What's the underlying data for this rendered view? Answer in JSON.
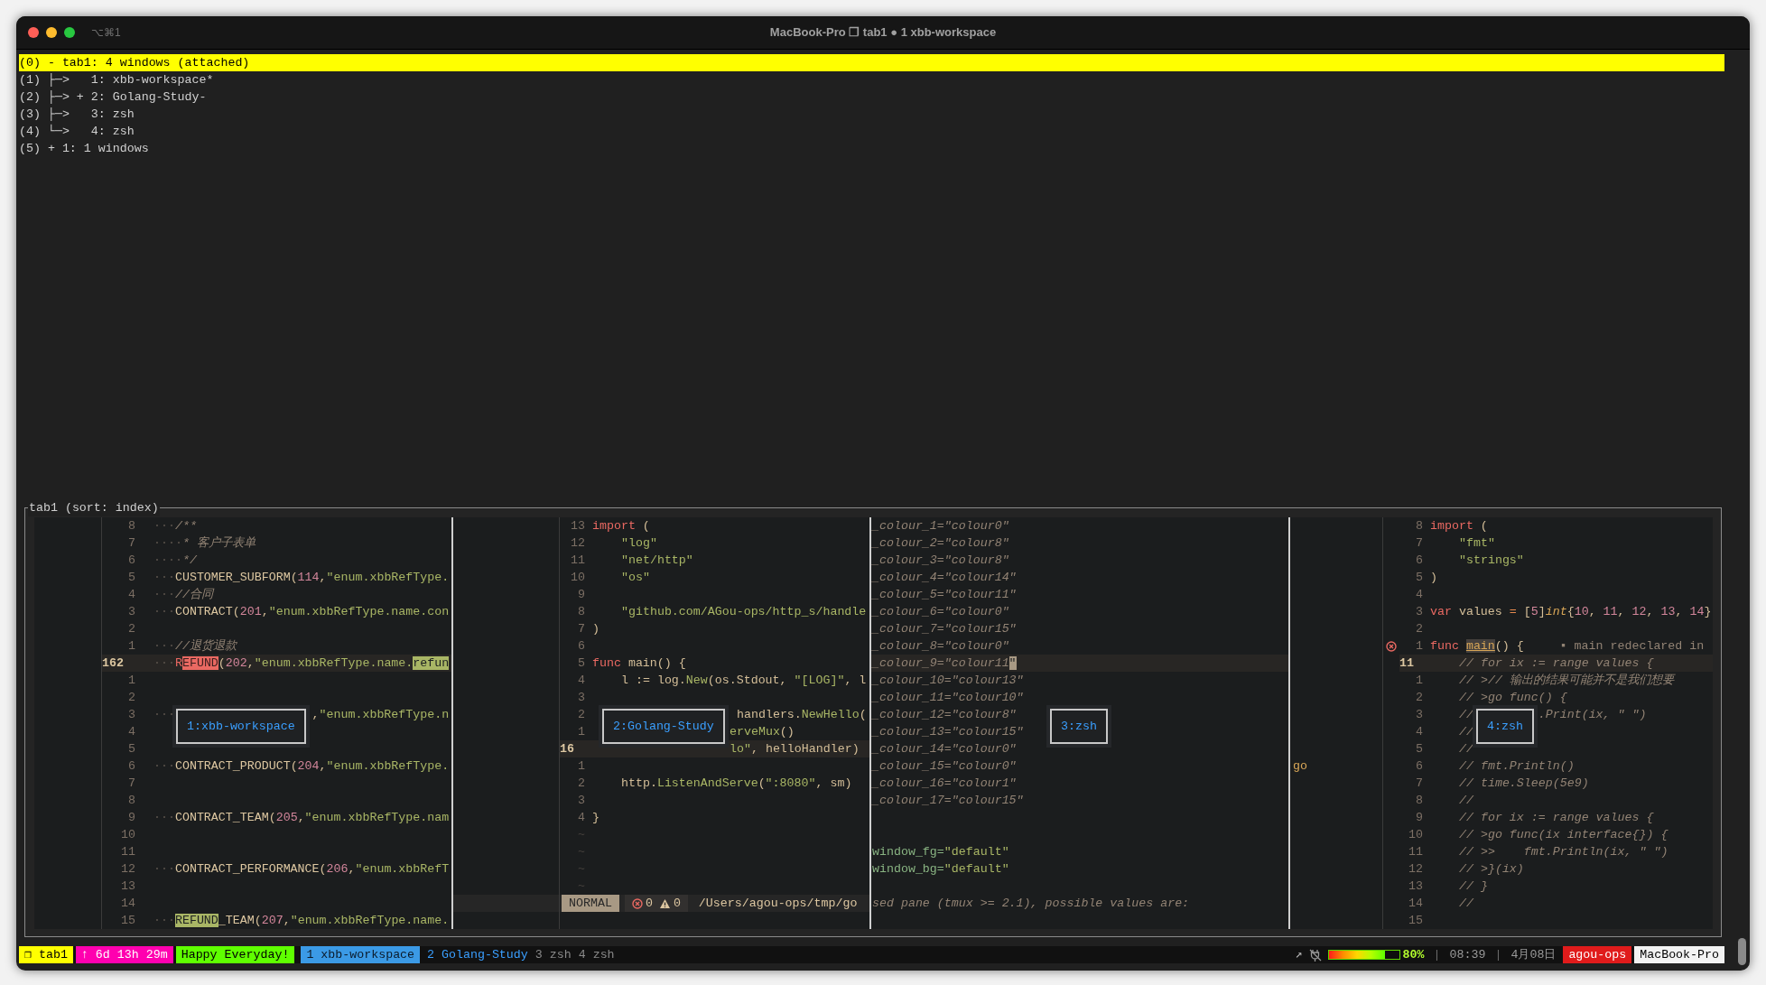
{
  "window": {
    "title": "MacBook-Pro ❐ tab1 ● 1 xbb-workspace",
    "shortcut": "⌥⌘1"
  },
  "tree": [
    {
      "index": "(0)",
      "marker": "-",
      "label": "tab1: 4 windows (attached)",
      "selected": true,
      "children": [
        {
          "index": "(1)",
          "branch": "├─>",
          "label": "1: xbb-workspace*",
          "selected": false
        },
        {
          "index": "(2)",
          "branch": "├─>",
          "marker": "+",
          "label": "2: Golang-Study-",
          "selected": false
        },
        {
          "index": "(3)",
          "branch": "├─>",
          "label": "3: zsh",
          "selected": false
        },
        {
          "index": "(4)",
          "branch": "└─>",
          "label": "4: zsh",
          "selected": false
        }
      ]
    },
    {
      "index": "(5)",
      "marker": "+",
      "label": "1: 1 windows",
      "selected": false
    }
  ],
  "preview": {
    "title": "tab1 (sort: index)",
    "panes": [
      {
        "label": "1:xbb-workspace",
        "rows": [
          {
            "num": "8",
            "current": false,
            "segments": [
              {
                "text": "···",
                "kind": "ws"
              },
              {
                "text": "/**",
                "kind": "comment"
              }
            ]
          },
          {
            "num": "7",
            "current": false,
            "segments": [
              {
                "text": "····",
                "kind": "ws"
              },
              {
                "text": "* 客户子表单",
                "kind": "comment"
              }
            ]
          },
          {
            "num": "6",
            "current": false,
            "segments": [
              {
                "text": "····",
                "kind": "ws"
              },
              {
                "text": "*/",
                "kind": "comment"
              }
            ]
          },
          {
            "num": "5",
            "current": false,
            "segments": [
              {
                "text": "···",
                "kind": "ws"
              },
              {
                "text": "CUSTOMER_SUBFORM",
                "kind": "ident"
              },
              {
                "text": "(",
                "kind": "plain"
              },
              {
                "text": "114",
                "kind": "number"
              },
              {
                "text": ",",
                "kind": "plain"
              },
              {
                "text": "\"enum.xbbRefType.",
                "kind": "string"
              }
            ]
          },
          {
            "num": "4",
            "current": false,
            "segments": [
              {
                "text": "···",
                "kind": "ws"
              },
              {
                "text": "//合同",
                "kind": "comment"
              }
            ]
          },
          {
            "num": "3",
            "current": false,
            "segments": [
              {
                "text": "···",
                "kind": "ws"
              },
              {
                "text": "CONTRACT",
                "kind": "ident"
              },
              {
                "text": "(",
                "kind": "plain"
              },
              {
                "text": "201",
                "kind": "number"
              },
              {
                "text": ",",
                "kind": "plain"
              },
              {
                "text": "\"enum.xbbRefType.name.con",
                "kind": "string"
              }
            ]
          },
          {
            "num": "2",
            "current": false
          },
          {
            "num": "1",
            "current": false,
            "segments": [
              {
                "text": "···",
                "kind": "ws"
              },
              {
                "text": "//退货退款",
                "kind": "comment"
              }
            ]
          },
          {
            "num": "162",
            "current": true,
            "segments": [
              {
                "text": "···",
                "kind": "ws"
              },
              {
                "text": "R",
                "kind": "keyword"
              },
              {
                "text": "EFUND",
                "kind": "match"
              },
              {
                "text": "(",
                "kind": "plain"
              },
              {
                "text": "202",
                "kind": "number"
              },
              {
                "text": ",",
                "kind": "plain"
              },
              {
                "text": "\"enum.xbbRefType.name.",
                "kind": "string"
              },
              {
                "text": "refun",
                "kind": "search"
              }
            ]
          },
          {
            "num": "1",
            "current": false
          },
          {
            "num": "2",
            "current": false
          },
          {
            "num": "3",
            "current": false,
            "segments": [
              {
                "text": "···",
                "kind": "ws"
              },
              {
                "text": "                   ,",
                "kind": "plain"
              },
              {
                "text": "\"enum.xbbRefType.n",
                "kind": "string"
              }
            ]
          },
          {
            "num": "4",
            "current": false
          },
          {
            "num": "5",
            "current": false
          },
          {
            "num": "6",
            "current": false,
            "segments": [
              {
                "text": "···",
                "kind": "ws"
              },
              {
                "text": "CONTRACT_PRODUCT",
                "kind": "ident"
              },
              {
                "text": "(",
                "kind": "plain"
              },
              {
                "text": "204",
                "kind": "number"
              },
              {
                "text": ",",
                "kind": "plain"
              },
              {
                "text": "\"enum.xbbRefType.",
                "kind": "string"
              }
            ]
          },
          {
            "num": "7",
            "current": false
          },
          {
            "num": "8",
            "current": false
          },
          {
            "num": "9",
            "current": false,
            "segments": [
              {
                "text": "···",
                "kind": "ws"
              },
              {
                "text": "CONTRACT_TEAM",
                "kind": "ident"
              },
              {
                "text": "(",
                "kind": "plain"
              },
              {
                "text": "205",
                "kind": "number"
              },
              {
                "text": ",",
                "kind": "plain"
              },
              {
                "text": "\"enum.xbbRefType.nam",
                "kind": "string"
              }
            ]
          },
          {
            "num": "10",
            "current": false
          },
          {
            "num": "11",
            "current": false
          },
          {
            "num": "12",
            "current": false,
            "segments": [
              {
                "text": "···",
                "kind": "ws"
              },
              {
                "text": "CONTRACT_PERFORMANCE",
                "kind": "ident"
              },
              {
                "text": "(",
                "kind": "plain"
              },
              {
                "text": "206",
                "kind": "number"
              },
              {
                "text": ",",
                "kind": "plain"
              },
              {
                "text": "\"enum.xbbRefT",
                "kind": "string"
              }
            ]
          },
          {
            "num": "13",
            "current": false
          },
          {
            "num": "14",
            "current": false
          },
          {
            "num": "15",
            "current": false,
            "segments": [
              {
                "text": "···",
                "kind": "ws"
              },
              {
                "text": "REFUND",
                "kind": "search"
              },
              {
                "text": "_TEAM",
                "kind": "ident"
              },
              {
                "text": "(",
                "kind": "plain"
              },
              {
                "text": "207",
                "kind": "number"
              },
              {
                "text": ",",
                "kind": "plain"
              },
              {
                "text": "\"enum.xbbRefType.name.",
                "kind": "string"
              }
            ]
          }
        ]
      },
      {
        "label": "2:Golang-Study",
        "rows": [
          {
            "num": "13",
            "current": false,
            "segments": [
              {
                "text": "import",
                "kind": "keyword"
              },
              {
                "text": " (",
                "kind": "plain"
              }
            ]
          },
          {
            "num": "12",
            "current": false,
            "segments": [
              {
                "text": "    \"log\"",
                "kind": "string"
              }
            ]
          },
          {
            "num": "11",
            "current": false,
            "segments": [
              {
                "text": "    \"net/http\"",
                "kind": "string"
              }
            ]
          },
          {
            "num": "10",
            "current": false,
            "segments": [
              {
                "text": "    \"os\"",
                "kind": "string"
              }
            ]
          },
          {
            "num": "9",
            "current": false
          },
          {
            "num": "8",
            "current": false,
            "segments": [
              {
                "text": "    \"github.com/AGou-ops/http_s/handle",
                "kind": "string"
              }
            ]
          },
          {
            "num": "7",
            "current": false,
            "segments": [
              {
                "text": ")",
                "kind": "plain"
              }
            ]
          },
          {
            "num": "6",
            "current": false
          },
          {
            "num": "5",
            "current": false,
            "segments": [
              {
                "text": "func",
                "kind": "keyword"
              },
              {
                "text": " main() {",
                "kind": "plain"
              }
            ]
          },
          {
            "num": "4",
            "current": false,
            "segments": [
              {
                "text": "    l := log.",
                "kind": "plain"
              },
              {
                "text": "New",
                "kind": "func"
              },
              {
                "text": "(os.Stdout, ",
                "kind": "plain"
              },
              {
                "text": "\"[LOG]\"",
                "kind": "string"
              },
              {
                "text": ", l",
                "kind": "plain"
              }
            ]
          },
          {
            "num": "3",
            "current": false
          },
          {
            "num": "2",
            "current": false,
            "segments": [
              {
                "text": "                    handlers.",
                "kind": "plain"
              },
              {
                "text": "NewHello",
                "kind": "func"
              },
              {
                "text": "(",
                "kind": "plain"
              }
            ]
          },
          {
            "num": "1",
            "current": false,
            "segments": [
              {
                "text": "                   erveMux",
                "kind": "func"
              },
              {
                "text": "()",
                "kind": "plain"
              }
            ]
          },
          {
            "num": "16",
            "current": true,
            "segments": [
              {
                "text": "                   lo\"",
                "kind": "string"
              },
              {
                "text": ", helloHandler)",
                "kind": "plain"
              }
            ]
          },
          {
            "num": "1",
            "current": false
          },
          {
            "num": "2",
            "current": false,
            "segments": [
              {
                "text": "    http.",
                "kind": "plain"
              },
              {
                "text": "ListenAndServe",
                "kind": "func"
              },
              {
                "text": "(",
                "kind": "plain"
              },
              {
                "text": "\":8080\"",
                "kind": "string"
              },
              {
                "text": ", sm)",
                "kind": "plain"
              }
            ]
          },
          {
            "num": "3",
            "current": false
          },
          {
            "num": "4",
            "current": false,
            "segments": [
              {
                "text": "}",
                "kind": "plain"
              }
            ]
          },
          {
            "num": "~",
            "kind": "filler",
            "current": false
          },
          {
            "num": "~",
            "kind": "filler",
            "current": false
          },
          {
            "num": "~",
            "kind": "filler",
            "current": false
          },
          {
            "num": "~",
            "kind": "filler",
            "current": false
          },
          {
            "kind": "statusline",
            "mode": "NORMAL",
            "errors": "0",
            "warnings": "0",
            "path": "/Users/agou-ops/tmp/go"
          },
          {
            "current": false
          }
        ]
      },
      {
        "label": "3:zsh",
        "rows": [
          {
            "current": false,
            "segments": [
              {
                "text": "_colour_1=\"colour0\"",
                "kind": "comment"
              }
            ]
          },
          {
            "current": false,
            "segments": [
              {
                "text": "_colour_2=\"colour8\"",
                "kind": "comment"
              }
            ]
          },
          {
            "current": false,
            "segments": [
              {
                "text": "_colour_3=\"colour8\"",
                "kind": "comment"
              }
            ]
          },
          {
            "current": false,
            "segments": [
              {
                "text": "_colour_4=\"colour14\"",
                "kind": "comment"
              }
            ]
          },
          {
            "current": false,
            "segments": [
              {
                "text": "_colour_5=\"colour11\"",
                "kind": "comment"
              }
            ]
          },
          {
            "current": false,
            "segments": [
              {
                "text": "_colour_6=\"colour0\"",
                "kind": "comment"
              }
            ]
          },
          {
            "current": false,
            "segments": [
              {
                "text": "_colour_7=\"colour15\"",
                "kind": "comment"
              }
            ]
          },
          {
            "current": false,
            "segments": [
              {
                "text": "_colour_8=\"colour0\"",
                "kind": "comment"
              }
            ]
          },
          {
            "current": true,
            "segments": [
              {
                "text": "_colour_9=\"colour11",
                "kind": "comment"
              },
              {
                "text": "\"",
                "kind": "cursor"
              }
            ]
          },
          {
            "current": false,
            "segments": [
              {
                "text": "_colour_10=\"colour13\"",
                "kind": "comment"
              }
            ]
          },
          {
            "current": false,
            "segments": [
              {
                "text": "_colour_11=\"colour10\"",
                "kind": "comment"
              }
            ]
          },
          {
            "current": false,
            "segments": [
              {
                "text": "_colour_12=\"colour8\"",
                "kind": "comment"
              }
            ]
          },
          {
            "current": false,
            "segments": [
              {
                "text": "_colour_13=\"colour15\"",
                "kind": "comment"
              }
            ]
          },
          {
            "current": false,
            "segments": [
              {
                "text": "_colour_14=\"colour0\"",
                "kind": "comment"
              }
            ]
          },
          {
            "current": false,
            "segments": [
              {
                "text": "_colour_15=\"colour0\"",
                "kind": "comment"
              }
            ]
          },
          {
            "current": false,
            "segments": [
              {
                "text": "_colour_16=\"colour1\"",
                "kind": "comment"
              }
            ]
          },
          {
            "current": false,
            "segments": [
              {
                "text": "_colour_17=\"colour15\"",
                "kind": "comment"
              }
            ]
          },
          {
            "current": false
          },
          {
            "current": false
          },
          {
            "current": false,
            "segments": [
              {
                "text": "window_fg=",
                "kind": "field"
              },
              {
                "text": "\"default\"",
                "kind": "string"
              }
            ]
          },
          {
            "current": false,
            "segments": [
              {
                "text": "window_bg=",
                "kind": "field"
              },
              {
                "text": "\"default\"",
                "kind": "string"
              }
            ]
          },
          {
            "current": false
          },
          {
            "current": false,
            "segments": [
              {
                "text": "sed pane (tmux >= 2.1), possible values are:",
                "kind": "comment"
              }
            ]
          },
          {
            "current": false
          }
        ]
      },
      {
        "label": "4:zsh",
        "rows": [
          {
            "num": "8",
            "current": false,
            "segments": [
              {
                "text": "import",
                "kind": "keyword"
              },
              {
                "text": " (",
                "kind": "plain"
              }
            ]
          },
          {
            "num": "7",
            "current": false,
            "segments": [
              {
                "text": "    \"fmt\"",
                "kind": "string"
              }
            ]
          },
          {
            "num": "6",
            "current": false,
            "segments": [
              {
                "text": "    \"strings\"",
                "kind": "string"
              }
            ]
          },
          {
            "num": "5",
            "current": false,
            "segments": [
              {
                "text": ")",
                "kind": "plain"
              }
            ]
          },
          {
            "num": "4",
            "current": false
          },
          {
            "num": "3",
            "current": false,
            "segments": [
              {
                "text": "var",
                "kind": "keyword"
              },
              {
                "text": " values ",
                "kind": "plain"
              },
              {
                "text": "=",
                "kind": "operator"
              },
              {
                "text": " [",
                "kind": "plain"
              },
              {
                "text": "5",
                "kind": "number"
              },
              {
                "text": "]",
                "kind": "plain"
              },
              {
                "text": "int",
                "kind": "type"
              },
              {
                "text": "{",
                "kind": "plain"
              },
              {
                "text": "10",
                "kind": "number"
              },
              {
                "text": ", ",
                "kind": "plain"
              },
              {
                "text": "11",
                "kind": "number"
              },
              {
                "text": ", ",
                "kind": "plain"
              },
              {
                "text": "12",
                "kind": "number"
              },
              {
                "text": ", ",
                "kind": "plain"
              },
              {
                "text": "13",
                "kind": "number"
              },
              {
                "text": ", ",
                "kind": "plain"
              },
              {
                "text": "14",
                "kind": "number"
              },
              {
                "text": "}",
                "kind": "plain"
              }
            ]
          },
          {
            "num": "2",
            "current": false
          },
          {
            "num": "1",
            "kind": "diagnostic",
            "current": false,
            "segments": [
              {
                "text": "func ",
                "kind": "keyword"
              },
              {
                "text": "main",
                "kind": "ref"
              },
              {
                "text": "() {",
                "kind": "plain"
              },
              {
                "text": "     ▪ main redeclared in",
                "kind": "hint"
              }
            ]
          },
          {
            "num": "11",
            "current": true,
            "segments": [
              {
                "text": "    // for ix := range values {",
                "kind": "comment"
              }
            ]
          },
          {
            "num": "1",
            "current": false,
            "segments": [
              {
                "text": "    // >// 输出的结果可能并不是我们想要",
                "kind": "comment"
              }
            ]
          },
          {
            "num": "2",
            "current": false,
            "segments": [
              {
                "text": "    // >go func() {",
                "kind": "comment"
              }
            ]
          },
          {
            "num": "3",
            "current": false,
            "segments": [
              {
                "text": "    //         .Print(ix, \" \")",
                "kind": "comment"
              }
            ]
          },
          {
            "num": "4",
            "current": false,
            "segments": [
              {
                "text": "    //",
                "kind": "comment"
              }
            ]
          },
          {
            "num": "5",
            "current": false,
            "segments": [
              {
                "text": "    //",
                "kind": "comment"
              }
            ]
          },
          {
            "num": "6",
            "aside": "go",
            "current": false,
            "segments": [
              {
                "text": "    // fmt.Println()",
                "kind": "comment"
              }
            ]
          },
          {
            "num": "7",
            "current": false,
            "segments": [
              {
                "text": "    // time.Sleep(5e9)",
                "kind": "comment"
              }
            ]
          },
          {
            "num": "8",
            "current": false,
            "segments": [
              {
                "text": "    //",
                "kind": "comment"
              }
            ]
          },
          {
            "num": "9",
            "current": false,
            "segments": [
              {
                "text": "    // for ix := range values {",
                "kind": "comment"
              }
            ]
          },
          {
            "num": "10",
            "current": false,
            "segments": [
              {
                "text": "    // >go func(ix interface{}) {",
                "kind": "comment"
              }
            ]
          },
          {
            "num": "11",
            "current": false,
            "segments": [
              {
                "text": "    // >>    fmt.Println(ix, \" \")",
                "kind": "comment"
              }
            ]
          },
          {
            "num": "12",
            "current": false,
            "segments": [
              {
                "text": "    // >}(ix)",
                "kind": "comment"
              }
            ]
          },
          {
            "num": "13",
            "current": false,
            "segments": [
              {
                "text": "    // }",
                "kind": "comment"
              }
            ]
          },
          {
            "num": "14",
            "current": false,
            "segments": [
              {
                "text": "    //",
                "kind": "comment"
              }
            ]
          },
          {
            "num": "15",
            "current": false
          }
        ]
      }
    ]
  },
  "status_bar": {
    "left": [
      {
        "kind": "session",
        "text": "❐ tab1"
      },
      {
        "kind": "uptime",
        "text": "↑ 6d 13h 29m"
      },
      {
        "kind": "message",
        "text": "Happy Everyday!"
      }
    ],
    "windows": [
      {
        "label": "1 xbb-workspace",
        "selected": true,
        "previous": false
      },
      {
        "label": "2 Golang-Study",
        "selected": false,
        "previous": true
      },
      {
        "label": "3 zsh",
        "selected": false,
        "previous": false
      },
      {
        "label": "4 zsh",
        "selected": false,
        "previous": false
      }
    ],
    "right": [
      {
        "kind": "indicator",
        "text": "↗"
      },
      {
        "kind": "plug"
      },
      {
        "kind": "battery",
        "level": 0.8
      },
      {
        "kind": "percent",
        "text": "80%"
      },
      {
        "kind": "divider",
        "text": "|"
      },
      {
        "kind": "clock",
        "text": "08:39"
      },
      {
        "kind": "divider",
        "text": "|"
      },
      {
        "kind": "date",
        "text": "4月08日"
      },
      {
        "kind": "user",
        "text": "agou-ops"
      },
      {
        "kind": "host",
        "text": "MacBook-Pro"
      }
    ]
  }
}
